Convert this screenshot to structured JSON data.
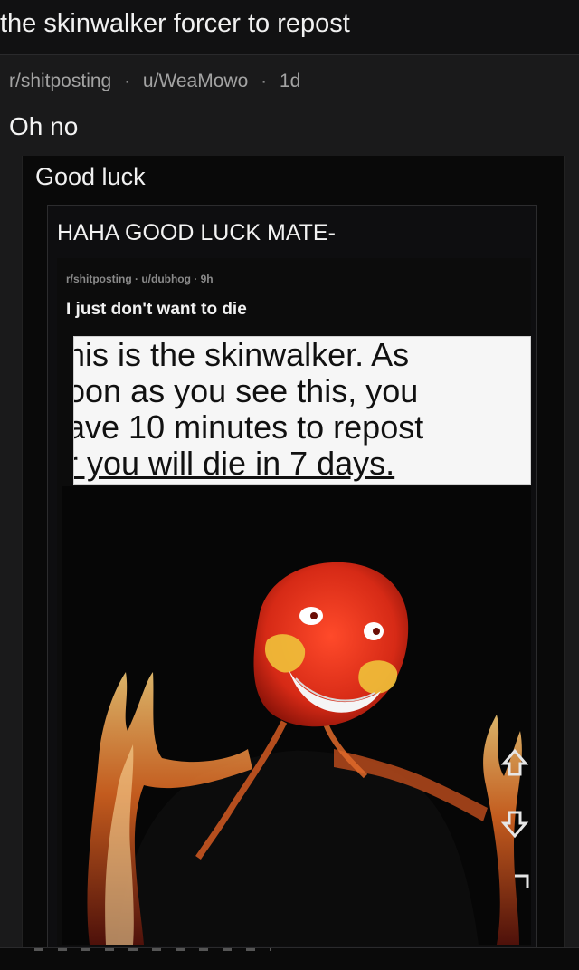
{
  "page": {
    "title": "the skinwalker forcer to repost",
    "post": {
      "subreddit": "r/shitposting",
      "user": "u/WeaMowo",
      "age": "1d",
      "title": "Oh no"
    },
    "nested_outer": {
      "title": "Good luck"
    },
    "nested_inner": {
      "title": "HAHA GOOD LUCK MATE-"
    },
    "nested_post": {
      "meta": "r/shitposting · u/dubhog · 9h",
      "title": "I just don't want to die"
    },
    "caption_lines": [
      "his is the skinwalker. As",
      "oon as you see this, you",
      "ave 10 minutes to repost",
      "r you will die in 7 days."
    ]
  }
}
